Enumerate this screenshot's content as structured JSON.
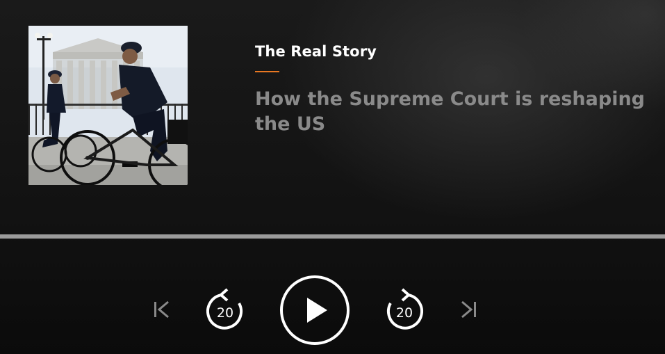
{
  "show": {
    "name": "The Real Story",
    "episode_title": "How the Supreme Court is reshaping the US"
  },
  "colors": {
    "accent": "#e87722",
    "title_text": "#ffffff",
    "episode_text": "#8a8a8a",
    "progress_track": "#9b9b9b"
  },
  "playback": {
    "progress_percent": 0
  },
  "controls": {
    "previous_icon": "skip-previous-icon",
    "rewind_icon": "rewind-icon",
    "rewind_seconds": "20",
    "play_icon": "play-icon",
    "forward_icon": "forward-icon",
    "forward_seconds": "20",
    "next_icon": "skip-next-icon"
  }
}
